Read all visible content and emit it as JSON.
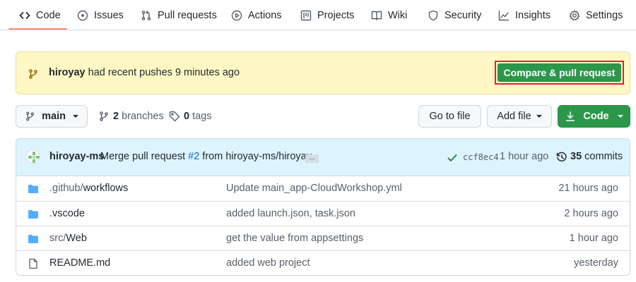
{
  "nav": {
    "tabs": [
      {
        "label": "Code",
        "icon": "code-icon",
        "selected": true
      },
      {
        "label": "Issues",
        "icon": "issue-icon"
      },
      {
        "label": "Pull requests",
        "icon": "pull-request-icon"
      },
      {
        "label": "Actions",
        "icon": "play-icon"
      },
      {
        "label": "Projects",
        "icon": "project-icon"
      },
      {
        "label": "Wiki",
        "icon": "book-icon"
      },
      {
        "label": "Security",
        "icon": "shield-icon"
      },
      {
        "label": "Insights",
        "icon": "graph-icon"
      },
      {
        "label": "Settings",
        "icon": "gear-icon"
      }
    ],
    "accent_color": "#fd8c73"
  },
  "flash": {
    "user": "hiroyay",
    "message": "had recent pushes 9 minutes ago",
    "compare_button": "Compare & pull request",
    "background": "#fff8c5",
    "highlight_color": "#e5202e"
  },
  "toolbar": {
    "branch": "main",
    "branches_count": "2",
    "branches_label": "branches",
    "tags_count": "0",
    "tags_label": "tags",
    "go_to_file": "Go to file",
    "add_file": "Add file",
    "code": "Code",
    "primary_color": "#2c974b"
  },
  "commit": {
    "author": "hiroyay-ms",
    "message_prefix": "Merge pull request",
    "pr_number": "#2",
    "message_suffix": "from hiroyay-ms/hiroyay",
    "ellipsis": "…",
    "sha": "ccf8ec4",
    "time": "1 hour ago",
    "commits_count": "35",
    "commits_label": "commits"
  },
  "files": [
    {
      "type": "directory",
      "name_dim": ".github/",
      "name": "workflows",
      "message": "Update main_app-CloudWorkshop.yml",
      "age": "21 hours ago"
    },
    {
      "type": "directory",
      "name_dim": "",
      "name": ".vscode",
      "message": "added launch.json, task.json",
      "age": "2 hours ago"
    },
    {
      "type": "directory",
      "name_dim": "src/",
      "name": "Web",
      "message": "get the value from appsettings",
      "age": "1 hour ago"
    },
    {
      "type": "file",
      "name_dim": "",
      "name": "README.md",
      "message": "added web project",
      "age": "yesterday"
    }
  ]
}
